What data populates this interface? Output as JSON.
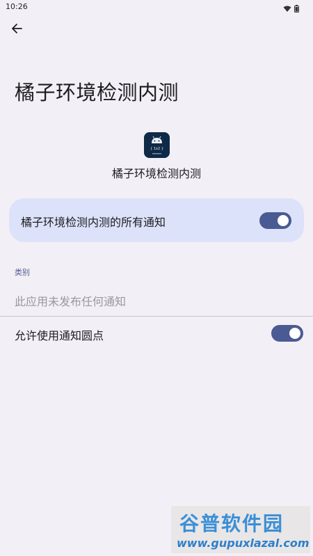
{
  "status_bar": {
    "time": "10:26",
    "wifi_icon": "wifi-icon",
    "battery_icon": "battery-icon"
  },
  "header": {
    "back_icon": "arrow-back-icon",
    "title": "橘子环境检测内测"
  },
  "app": {
    "icon": "android-app-icon",
    "icon_text": "{ 1x2 }",
    "name": "橘子环境检测内测"
  },
  "master_toggle": {
    "label": "橘子环境检测内测的所有通知",
    "enabled": true
  },
  "categories": {
    "section_label": "类别",
    "empty_text": "此应用未发布任何通知"
  },
  "notification_dots": {
    "label": "允许使用通知圆点",
    "enabled": true
  },
  "watermark": {
    "title": "谷普软件园",
    "url": "www.gupuxlazal.com"
  },
  "colors": {
    "background": "#f3eff6",
    "card": "#dce2f9",
    "toggle_track": "#4a5a92",
    "section_label": "#4f5b92"
  }
}
